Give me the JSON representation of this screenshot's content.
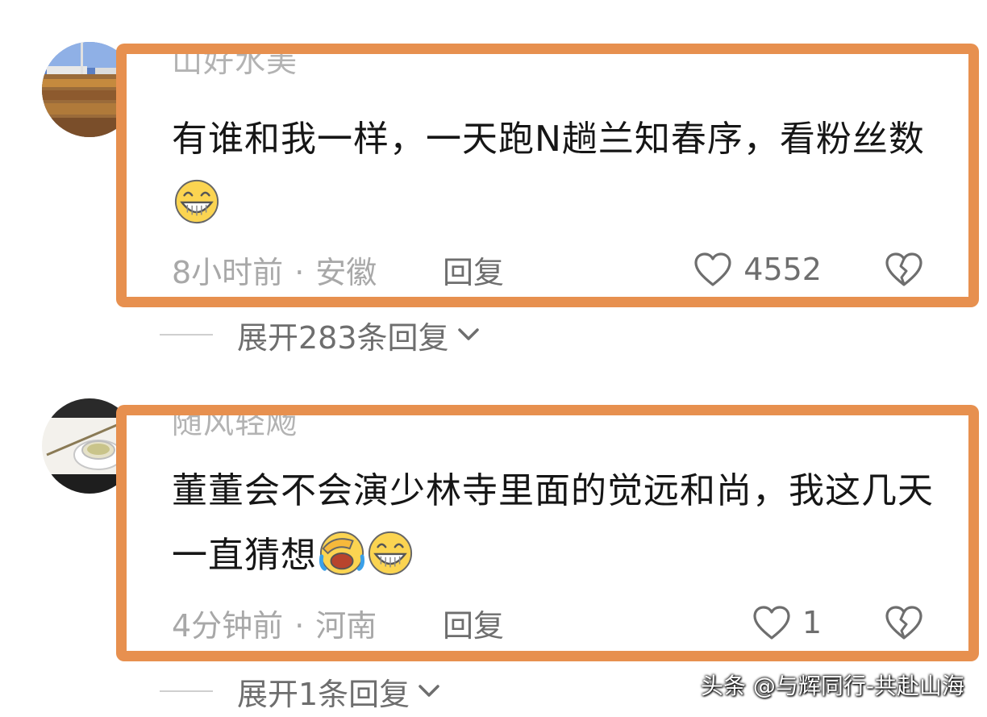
{
  "comments": [
    {
      "username": "山好水美",
      "content": "有谁和我一样，一天跑N趟兰知春序，看粉丝数",
      "emoji": [
        "grinning-face"
      ],
      "time": "8小时前",
      "separator": "·",
      "location": "安徽",
      "reply_label": "回复",
      "like_count": "4552",
      "expand_label": "展开283条回复"
    },
    {
      "username": "随风轻飏",
      "content": "董董会不会演少林寺里面的觉远和尚，我这几天一直猜想",
      "emoji": [
        "facepalm-laugh-face",
        "grinning-face"
      ],
      "time": "4分钟前",
      "separator": "·",
      "location": "河南",
      "reply_label": "回复",
      "like_count": "1",
      "expand_label": "展开1条回复"
    }
  ],
  "watermark": "头条 @与辉同行-共赴山海",
  "colors": {
    "highlight_border": "#e7904f",
    "username_text": "#b3b3b3",
    "meta_text": "#a8a8a8",
    "action_text": "#6e6e6e"
  }
}
